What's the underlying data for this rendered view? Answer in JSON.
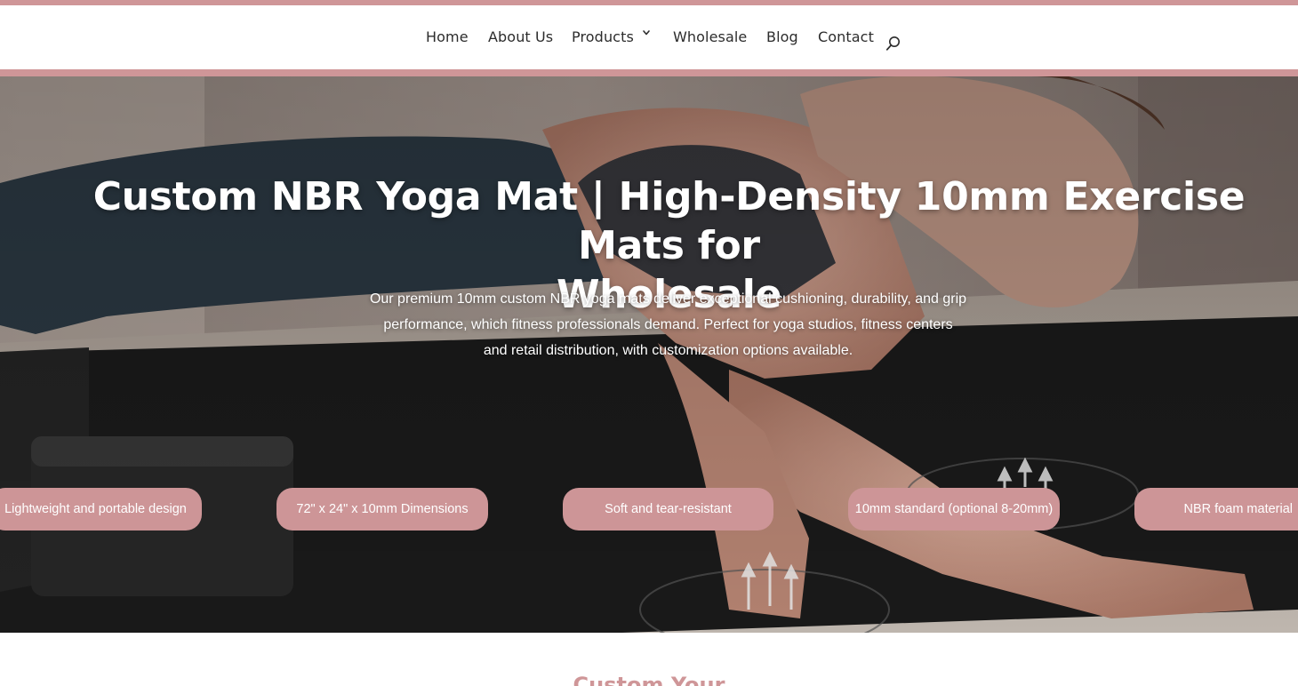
{
  "nav": {
    "items": [
      {
        "label": "Home"
      },
      {
        "label": "About Us"
      },
      {
        "label": "Products"
      },
      {
        "label": "Wholesale"
      },
      {
        "label": "Blog"
      },
      {
        "label": "Contact"
      }
    ],
    "search_icon": "search-icon",
    "dropdown_icon": "chevron-down-icon"
  },
  "hero": {
    "title_line1": "Custom NBR Yoga Mat | High-Density 10mm Exercise Mats for",
    "title_line2": "Wholesale",
    "subtitle_line1": "Our premium 10mm custom NBR yoga mats deliver exceptional cushioning, durability, and grip",
    "subtitle_line2": "performance, which fitness professionals demand. Perfect for yoga studios, fitness centers",
    "subtitle_line3": "and retail distribution, with customization options available.",
    "features": [
      {
        "label": "Lightweight and portable design"
      },
      {
        "label": "72\" x 24\" x 10mm Dimensions"
      },
      {
        "label": "Soft and tear-resistant"
      },
      {
        "label": "10mm standard (optional 8-20mm)"
      },
      {
        "label": "NBR foam material"
      }
    ]
  },
  "section": {
    "title": "Custom Your"
  },
  "colors": {
    "accent": "#cf9698",
    "pill": "#cd9597",
    "nav_text": "#2c2c2c",
    "hero_text": "#ffffff"
  }
}
